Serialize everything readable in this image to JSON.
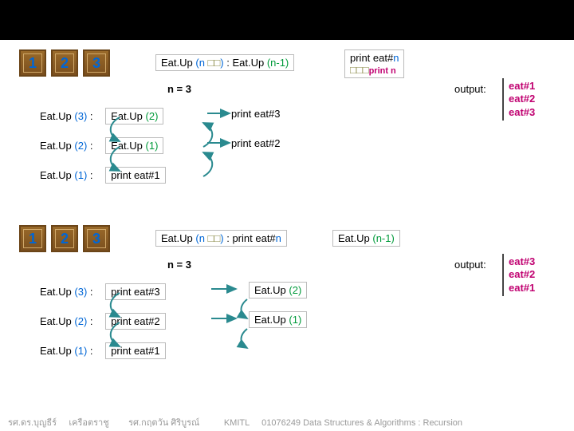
{
  "blocks": [
    "1",
    "2",
    "3"
  ],
  "top": {
    "def_prefix": "Eat.Up ",
    "def_paren_l": "(",
    "def_n": "n",
    "def_sq": " □□",
    "def_paren_r": ")",
    "def_colon": " : ",
    "def_rec_prefix": "Eat.Up ",
    "def_rec_arg": "(n-1)",
    "printbox_l1_a": "print eat#",
    "printbox_l1_b": "n",
    "printbox_l2_a": "□□□",
    "printbox_l2_b": "print n",
    "n3": "n = 3",
    "output_label": "output:",
    "output": "eat#1\neat#2\neat#3",
    "rows": [
      {
        "call": "Eat.Up (3) :",
        "call_n": "3",
        "box": "Eat.Up (2)",
        "box_n": "2",
        "print": "print eat#3"
      },
      {
        "call": "Eat.Up (2) :",
        "call_n": "2",
        "box": "Eat.Up (1)",
        "box_n": "1",
        "print": "print eat#2"
      },
      {
        "call": "Eat.Up (1) :",
        "call_n": "1",
        "base": "print eat#1"
      }
    ]
  },
  "bottom": {
    "def_prefix": "Eat.Up ",
    "def_paren_l": "(",
    "def_n": "n",
    "def_sq": " □□",
    "def_paren_r": ")",
    "def_colon": " : ",
    "def_print_a": "print eat#",
    "def_print_b": "n",
    "def_rec_prefix": "Eat.Up ",
    "def_rec_arg": "(n-1)",
    "n3": "n = 3",
    "output_label": "output:",
    "output": "eat#3\neat#2\neat#1",
    "rows": [
      {
        "call": "Eat.Up (3) :",
        "call_n": "3",
        "print": "print eat#3",
        "box": "Eat.Up (2)",
        "box_n": "2"
      },
      {
        "call": "Eat.Up (2) :",
        "call_n": "2",
        "print": "print eat#2",
        "box": "Eat.Up (1)",
        "box_n": "1"
      },
      {
        "call": "Eat.Up (1) :",
        "call_n": "1",
        "base": "print eat#1"
      }
    ]
  },
  "footer": {
    "left1": "รศ.ดร.บุญธีร์",
    "left2": "เครือตราชู",
    "mid": "รศ.กฤตวัน  ศิริบูรณ์",
    "kmitl": "KMITL",
    "course": "01076249 Data Structures & Algorithms : Recursion"
  }
}
